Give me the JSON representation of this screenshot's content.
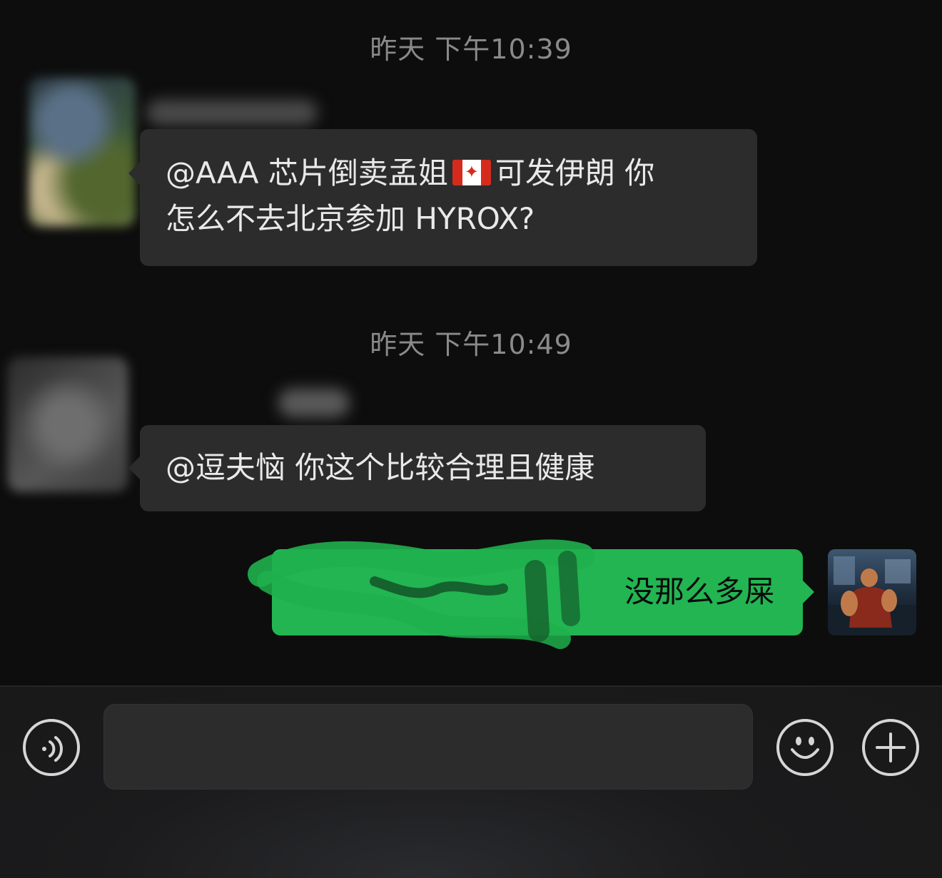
{
  "conversation": {
    "messages": [
      {
        "timestamp": "昨天 下午10:39",
        "sender": "other",
        "text_before_flag": "@AAA 芯片倒卖孟姐",
        "text_after_flag": "可发伊朗 你",
        "text_line2": "怎么不去北京参加 HYROX?"
      },
      {
        "timestamp": "昨天 下午10:49",
        "sender": "other",
        "text": "@逗夫恼 你这个比较合理且健康"
      },
      {
        "sender": "self",
        "text": "没那么多屎"
      }
    ]
  },
  "input_bar": {
    "voice_icon": "voice-wave-icon",
    "emoji_icon": "smiley-face-icon",
    "more_icon": "plus-icon",
    "text_value": ""
  },
  "colors": {
    "background": "#0d0d0d",
    "incoming_bubble": "#2c2c2c",
    "outgoing_bubble": "#22b552",
    "timestamp_text": "#8a8a8a"
  }
}
